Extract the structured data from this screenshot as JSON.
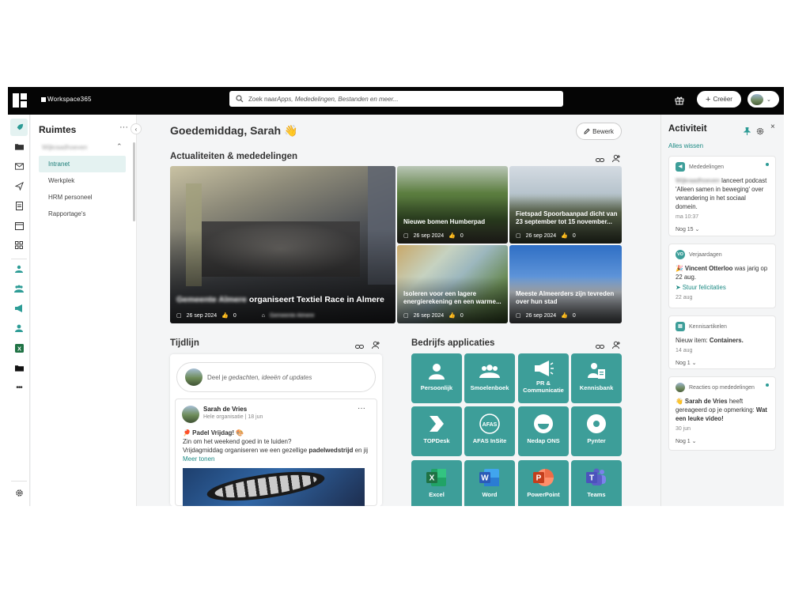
{
  "topbar": {
    "brand": "Workspace365",
    "search_prefix": "Zoek naar ",
    "search_hint": "Apps, Mededelingen, Bestanden en meer...",
    "create_label": "Creëer"
  },
  "spaces": {
    "title": "Ruimtes",
    "more": "···",
    "group_label": "Wijkraadhoeven",
    "items": [
      {
        "label": "Intranet",
        "active": true
      },
      {
        "label": "Werkplek",
        "active": false
      },
      {
        "label": "HRM personeel",
        "active": false
      },
      {
        "label": "Rapportage's",
        "active": false
      }
    ]
  },
  "main": {
    "greeting": "Goedemiddag, Sarah",
    "greeting_emoji": "👋",
    "edit_label": "Bewerk",
    "news_title": "Actualiteiten & mededelingen",
    "news": [
      {
        "blur_prefix": "Gemeente Almere",
        "title": "organiseert Textiel Race in Almere",
        "date": "26 sep 2024",
        "likes": "0",
        "tag": "Gemeente Almere"
      },
      {
        "title": "Nieuwe bomen Humberpad",
        "date": "26 sep 2024",
        "likes": "0"
      },
      {
        "title": "Fietspad Spoorbaanpad dicht van 23 september tot 15 november...",
        "date": "26 sep 2024",
        "likes": "0"
      },
      {
        "title": "Isoleren voor een lagere energierekening en een warme...",
        "date": "26 sep 2024",
        "likes": "0"
      },
      {
        "title": "Meeste Almeerders zijn tevreden over hun stad",
        "date": "26 sep 2024",
        "likes": "0"
      }
    ],
    "timeline_title": "Tijdlijn",
    "post_prompt_prefix": "Deel je ",
    "post_prompt_hint": "gedachten, ideeën of updates",
    "post": {
      "author": "Sarah de Vries",
      "audience": "Hele organisatie",
      "date": "18 jun",
      "line1": "🏓 Padel Vrijdag! 🎨",
      "line2": "Zin om het weekend goed in te luiden?",
      "line3_prefix": "Vrijdagmiddag organiseren we een gezellige ",
      "line3_bold": "padelwedstrijd",
      "line3_suffix": " en jij",
      "more": "Meer tonen"
    },
    "apps_title": "Bedrijfs applicaties",
    "apps": [
      {
        "label": "Persoonlijk",
        "icon": "person-icon"
      },
      {
        "label": "Smoelenboek",
        "icon": "group-icon"
      },
      {
        "label": "PR & Communicatie",
        "icon": "megaphone-icon"
      },
      {
        "label": "Kennisbank",
        "icon": "knowledge-icon"
      },
      {
        "label": "TOPDesk",
        "icon": "topdesk-icon"
      },
      {
        "label": "AFAS InSite",
        "icon": "afas-icon"
      },
      {
        "label": "Nedap ONS",
        "icon": "nedap-icon"
      },
      {
        "label": "Pynter",
        "icon": "pynter-icon"
      },
      {
        "label": "Excel",
        "icon": "excel-icon"
      },
      {
        "label": "Word",
        "icon": "word-icon"
      },
      {
        "label": "PowerPoint",
        "icon": "powerpoint-icon"
      },
      {
        "label": "Teams",
        "icon": "teams-icon"
      }
    ]
  },
  "activity": {
    "title": "Activiteit",
    "clear": "Alles wissen",
    "cards": [
      {
        "category": "Mededelingen",
        "blur_name": "Wijkraadhoeven",
        "text": "lanceert podcast 'Alleen samen in beweging' over verandering in het sociaal domein.",
        "time": "ma 10:37",
        "more": "Nog 15"
      },
      {
        "category": "Verjaardagen",
        "name": "Vincent Otterloo",
        "text": "was jarig op 22 aug.",
        "action": "Stuur felicitaties",
        "time": "22 aug"
      },
      {
        "category": "Kennisartikelen",
        "text_prefix": "Nieuw item: ",
        "text_bold": "Containers.",
        "time": "14 aug",
        "more": "Nog 1"
      },
      {
        "category": "Reacties op mededelingen",
        "name": "Sarah de Vries",
        "text": "heeft gereageerd op je opmerking:",
        "quote": "Wat een leuke video!",
        "time": "30 jun",
        "more": "Nog 1"
      }
    ]
  },
  "colors": {
    "accent": "#3d9e99",
    "topbar": "#050505",
    "excel": "#1f7244",
    "word": "#2b5bb8",
    "powerpoint": "#d14b26",
    "teams": "#5b5fc7"
  }
}
